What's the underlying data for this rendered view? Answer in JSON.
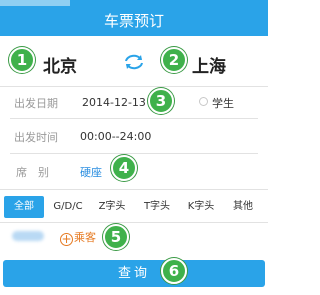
{
  "header": {
    "title": "车票预订"
  },
  "route": {
    "from": "北京",
    "to": "上海",
    "swap_icon": "swap-arrows-icon"
  },
  "depart_date": {
    "label": "出发日期",
    "value": "2014-12-13",
    "student_label": "学生"
  },
  "depart_time": {
    "label": "出发时间",
    "value": "00:00--24:00"
  },
  "seat": {
    "label": "席　别",
    "value": "硬座"
  },
  "train_types": [
    "全部",
    "G/D/C",
    "Z字头",
    "T字头",
    "K字头",
    "其他"
  ],
  "passenger": {
    "add_label": "乘客",
    "add_icon": "+"
  },
  "query_button": {
    "label": "查询"
  },
  "badges": [
    "1",
    "2",
    "3",
    "4",
    "5",
    "6"
  ],
  "colors": {
    "primary": "#2aa3e8",
    "badge": "#3fb14b",
    "accent": "#e67a22",
    "link": "#2a8ee0"
  }
}
